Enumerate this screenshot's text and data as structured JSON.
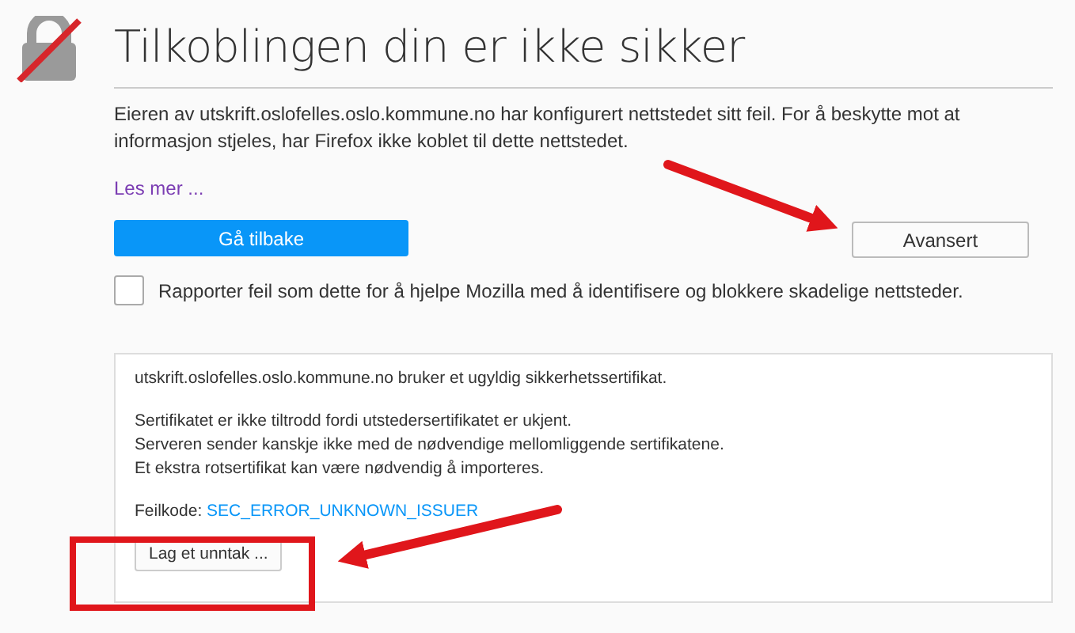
{
  "title": "Tilkoblingen din er ikke sikker",
  "description": "Eieren av utskrift.oslofelles.oslo.kommune.no har konfigurert nettstedet sitt feil. For å beskytte mot at informasjon stjeles, har Firefox ikke koblet til dette nettstedet.",
  "learn_more": "Les mer ...",
  "buttons": {
    "back": "Gå tilbake",
    "advanced": "Avansert"
  },
  "report": {
    "label": "Rapporter feil som dette for å hjelpe Mozilla med å identifisere og blokkere skadelige nettsteder.",
    "checked": false
  },
  "details": {
    "paragraphs": [
      [
        "utskrift.oslofelles.oslo.kommune.no bruker et ugyldig sikkerhetssertifikat."
      ],
      [
        "Sertifikatet er ikke tiltrodd fordi utstedersertifikatet er ukjent.",
        "Serveren sender kanskje ikke med de nødvendige mellomliggende sertifikatene.",
        "Et ekstra rotsertifikat kan være nødvendig å importeres."
      ]
    ],
    "error_label": "Feilkode:",
    "error_code": "SEC_ERROR_UNKNOWN_ISSUER",
    "exception_button": "Lag et unntak ..."
  }
}
